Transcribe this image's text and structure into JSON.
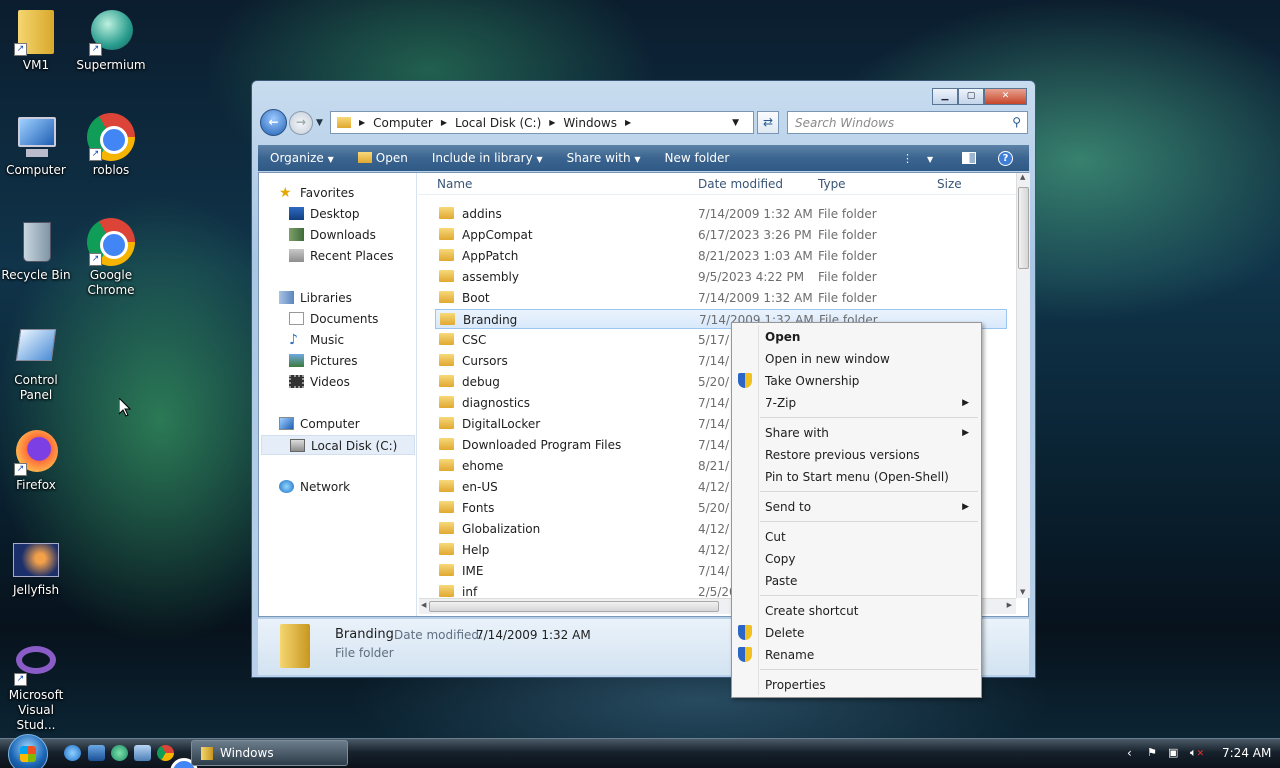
{
  "desktop": {
    "icons": [
      {
        "label": "VM1",
        "icon": "folder-shortcut-icon"
      },
      {
        "label": "Supermium",
        "icon": "supermium-icon"
      },
      {
        "label": "Computer",
        "icon": "computer-icon"
      },
      {
        "label": "roblos",
        "icon": "chrome-icon"
      },
      {
        "label": "Recycle Bin",
        "icon": "recycle-bin-icon"
      },
      {
        "label": "Google Chrome",
        "icon": "chrome-icon"
      },
      {
        "label": "Control Panel",
        "icon": "control-panel-icon"
      },
      {
        "label": "Firefox",
        "icon": "firefox-icon"
      },
      {
        "label": "Jellyfish",
        "icon": "jellyfish-image-icon"
      },
      {
        "label": "Microsoft Visual Stud...",
        "icon": "visual-studio-icon"
      }
    ]
  },
  "window": {
    "breadcrumb": [
      "Computer",
      "Local Disk (C:)",
      "Windows"
    ],
    "search_placeholder": "Search Windows",
    "toolbar": {
      "organize": "Organize",
      "open": "Open",
      "include_in_library": "Include in library",
      "share_with": "Share with",
      "new_folder": "New folder"
    },
    "nav": {
      "favorites": "Favorites",
      "desktop": "Desktop",
      "downloads": "Downloads",
      "recent_places": "Recent Places",
      "libraries": "Libraries",
      "documents": "Documents",
      "music": "Music",
      "pictures": "Pictures",
      "videos": "Videos",
      "computer": "Computer",
      "local_disk": "Local Disk (C:)",
      "network": "Network"
    },
    "columns": {
      "name": "Name",
      "date_modified": "Date modified",
      "type": "Type",
      "size": "Size"
    },
    "files": [
      {
        "name": "addins",
        "date": "7/14/2009 1:32 AM",
        "type": "File folder"
      },
      {
        "name": "AppCompat",
        "date": "6/17/2023 3:26 PM",
        "type": "File folder"
      },
      {
        "name": "AppPatch",
        "date": "8/21/2023 1:03 AM",
        "type": "File folder"
      },
      {
        "name": "assembly",
        "date": "9/5/2023 4:22 PM",
        "type": "File folder"
      },
      {
        "name": "Boot",
        "date": "7/14/2009 1:32 AM",
        "type": "File folder"
      },
      {
        "name": "Branding",
        "date": "7/14/2009 1:32 AM",
        "type": "File folder"
      },
      {
        "name": "CSC",
        "date": "5/17/",
        "type": ""
      },
      {
        "name": "Cursors",
        "date": "7/14/",
        "type": ""
      },
      {
        "name": "debug",
        "date": "5/20/",
        "type": ""
      },
      {
        "name": "diagnostics",
        "date": "7/14/",
        "type": ""
      },
      {
        "name": "DigitalLocker",
        "date": "7/14/",
        "type": ""
      },
      {
        "name": "Downloaded Program Files",
        "date": "7/14/",
        "type": ""
      },
      {
        "name": "ehome",
        "date": "8/21/",
        "type": ""
      },
      {
        "name": "en-US",
        "date": "4/12/",
        "type": ""
      },
      {
        "name": "Fonts",
        "date": "5/20/",
        "type": ""
      },
      {
        "name": "Globalization",
        "date": "4/12/",
        "type": ""
      },
      {
        "name": "Help",
        "date": "4/12/",
        "type": ""
      },
      {
        "name": "IME",
        "date": "7/14/",
        "type": ""
      },
      {
        "name": "inf",
        "date": "2/5/20",
        "type": ""
      }
    ],
    "details": {
      "name": "Branding",
      "date_label": "Date modified:",
      "date_value": "7/14/2009 1:32 AM",
      "type": "File folder"
    }
  },
  "context_menu": {
    "open": "Open",
    "open_new_window": "Open in new window",
    "take_ownership": "Take Ownership",
    "seven_zip": "7-Zip",
    "share_with": "Share with",
    "restore": "Restore previous versions",
    "pin_start": "Pin to Start menu (Open-Shell)",
    "send_to": "Send to",
    "cut": "Cut",
    "copy": "Copy",
    "paste": "Paste",
    "create_shortcut": "Create shortcut",
    "delete": "Delete",
    "rename": "Rename",
    "properties": "Properties"
  },
  "taskbar": {
    "task_label": "Windows",
    "clock": "7:24 AM"
  }
}
